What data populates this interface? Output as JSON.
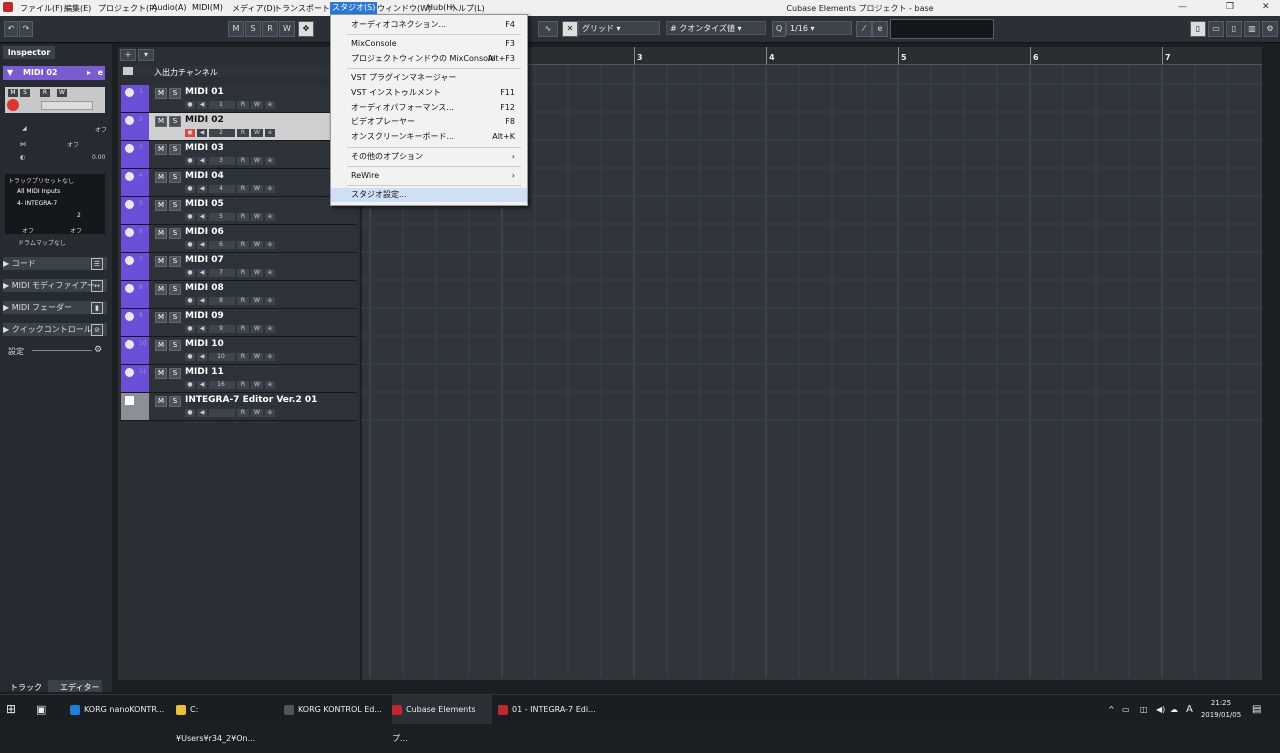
{
  "menubar": {
    "items": [
      "ファイル(F)",
      "編集(E)",
      "プロジェクト(P)",
      "Audio(A)",
      "MIDI(M)",
      "メディア(D)",
      "トランスポート(T)",
      "スタジオ(S)",
      "ウィンドウ(W)",
      "Hub(H)",
      "ヘルプ(L)"
    ],
    "app_title": "Cubase Elements プロジェクト - base"
  },
  "toolbar": {
    "msrw": [
      "M",
      "S",
      "R",
      "W"
    ],
    "grid_label": "グリッド",
    "quantize_label": "クオンタイズ値",
    "quantize_value": "1/16",
    "q_label": "Q"
  },
  "studio_menu": {
    "items": [
      {
        "label": "オーディオコネクション...",
        "shortcut": "F4"
      },
      {
        "label": "MixConsole",
        "shortcut": "F3"
      },
      {
        "label": "プロジェクトウィンドウの MixConsole",
        "shortcut": "Alt+F3"
      },
      {
        "label": "VST プラグインマネージャー",
        "shortcut": ""
      },
      {
        "label": "VST インストゥルメント",
        "shortcut": "F11"
      },
      {
        "label": "オーディオパフォーマンス...",
        "shortcut": "F12"
      },
      {
        "label": "ビデオプレーヤー",
        "shortcut": "F8"
      },
      {
        "label": "オンスクリーンキーボード...",
        "shortcut": "Alt+K"
      },
      {
        "label": "その他のオプション",
        "shortcut": "›"
      },
      {
        "label": "ReWire",
        "shortcut": "›"
      },
      {
        "label": "スタジオ設定...",
        "shortcut": ""
      }
    ]
  },
  "inspector": {
    "tab": "Inspector",
    "track_name": "MIDI 02",
    "off1": "オフ",
    "off2": "オフ",
    "val": "0.00",
    "preset": "トラックプリセットなし",
    "input": "All MIDI Inputs",
    "output": "4- INTEGRA-7",
    "channel": "2",
    "off3": "オフ",
    "off4": "オフ",
    "drummap": "ドラムマップなし",
    "sections": [
      "コード",
      "MIDI モディファイアー",
      "MIDI フェーダー",
      "クイックコントロール"
    ],
    "settings": "設定"
  },
  "tracklist": {
    "folder": "入出力チャンネル",
    "tracks": [
      {
        "name": "MIDI 01",
        "ch": "1"
      },
      {
        "name": "MIDI 02",
        "ch": "2"
      },
      {
        "name": "MIDI 03",
        "ch": "3"
      },
      {
        "name": "MIDI 04",
        "ch": "4"
      },
      {
        "name": "MIDI 05",
        "ch": "5"
      },
      {
        "name": "MIDI 06",
        "ch": "6"
      },
      {
        "name": "MIDI 07",
        "ch": "7"
      },
      {
        "name": "MIDI 08",
        "ch": "8"
      },
      {
        "name": "MIDI 09",
        "ch": "9"
      },
      {
        "name": "MIDI 10",
        "ch": "10"
      },
      {
        "name": "MIDI 11",
        "ch": "16"
      },
      {
        "name": "INTEGRA-7 Editor Ver.2 01",
        "ch": ""
      }
    ]
  },
  "ruler": {
    "marks": [
      "3",
      "4",
      "5",
      "6",
      "7"
    ]
  },
  "bottom_tabs": [
    "トラック",
    "エディター"
  ],
  "taskbar": {
    "items": [
      "KORG nanoKONTR...",
      "C:¥Users¥r34_2¥On...",
      "KORG KONTROL Ed...",
      "Cubase Elements プ...",
      "01 - INTEGRA-7 Edi..."
    ],
    "time": "21:25",
    "date": "2019/01/05",
    "ime": "A"
  }
}
